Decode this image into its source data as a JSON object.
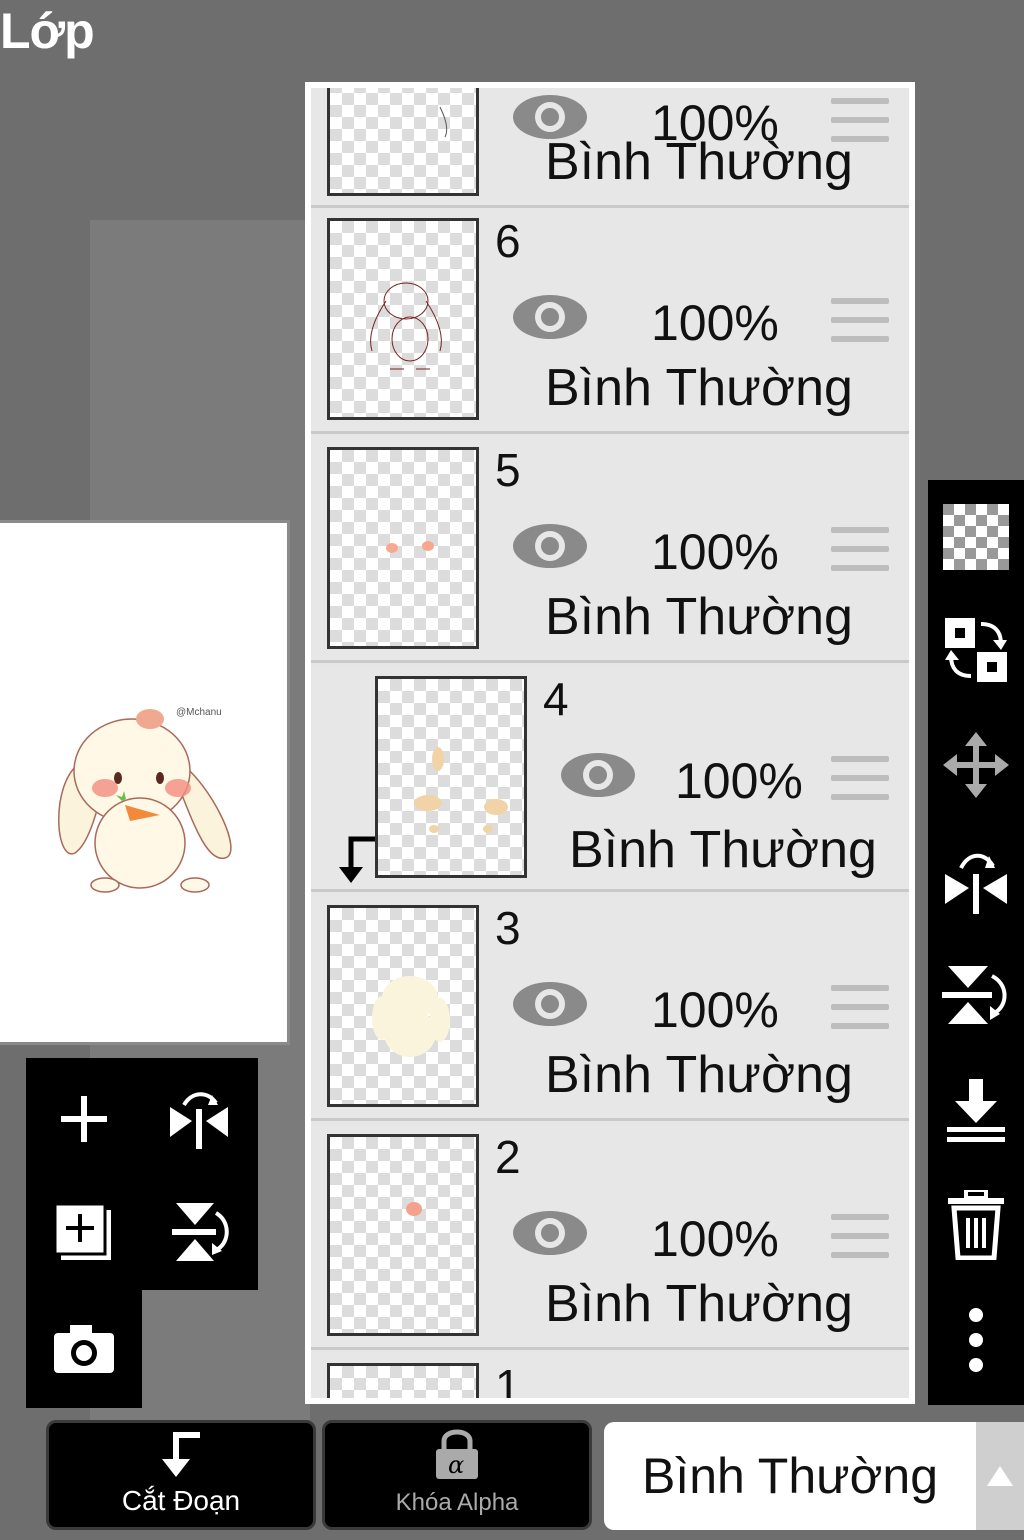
{
  "header": {
    "title": "Lớp"
  },
  "canvas": {
    "signature": "@Mchanu"
  },
  "layers": [
    {
      "number": "",
      "opacity": "100%",
      "mode": "Bình Thường",
      "visible": true
    },
    {
      "number": "6",
      "opacity": "100%",
      "mode": "Bình Thường",
      "visible": true
    },
    {
      "number": "5",
      "opacity": "100%",
      "mode": "Bình Thường",
      "visible": true
    },
    {
      "number": "4",
      "opacity": "100%",
      "mode": "Bình Thường",
      "visible": true,
      "clipped": true
    },
    {
      "number": "3",
      "opacity": "100%",
      "mode": "Bình Thường",
      "visible": true
    },
    {
      "number": "2",
      "opacity": "100%",
      "mode": "Bình Thường",
      "visible": true
    },
    {
      "number": "1"
    }
  ],
  "left_tools": [
    "plus-icon",
    "flip-horizontal-icon",
    "add-layer-copy-icon",
    "flip-vertical-icon",
    "camera-icon"
  ],
  "right_tools": [
    "transparency-icon",
    "swap-layers-icon",
    "move-icon",
    "flip-horizontal-icon",
    "flip-vertical-icon",
    "merge-down-icon",
    "trash-icon",
    "more-icon"
  ],
  "bottom": {
    "clip_label": "Cắt Đoạn",
    "alpha_lock_label": "Khóa Alpha",
    "blend_mode": "Bình Thường"
  },
  "colors": {
    "background": "#6e6e6e",
    "panel": "#e7e7e7",
    "toolbar": "#000000"
  }
}
